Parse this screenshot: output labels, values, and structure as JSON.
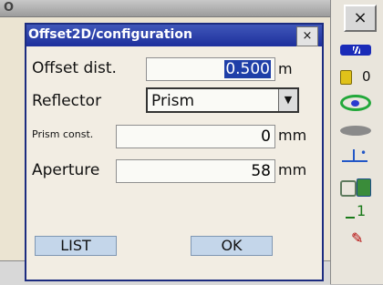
{
  "background": {
    "title_fragment": "O"
  },
  "status": {
    "close": "×",
    "memory_count": "0",
    "comm_step": "1",
    "icons": [
      "battery-icon",
      "memory-icon",
      "target-icon",
      "prism-disk-icon",
      "tilt-level-icon",
      "communication-icon",
      "step-one-icon",
      "edit-icon"
    ]
  },
  "dialog": {
    "title": "Offset2D/configuration",
    "close": "×",
    "offset_label": "Offset dist.",
    "offset_value": "0.500",
    "offset_unit": "m",
    "reflector_label": "Reflector",
    "reflector_value": "Prism",
    "dropdown_glyph": "▼",
    "prism_label": "Prism const.",
    "prism_value": "0",
    "prism_unit": "mm",
    "aperture_label": "Aperture",
    "aperture_value": "58",
    "aperture_unit": "mm"
  },
  "buttons": {
    "list": "LIST",
    "ok": "OK"
  },
  "colors": {
    "title_bar": "#1d2f9c",
    "selection": "#1f3fa8",
    "button": "#c4d6ea"
  }
}
